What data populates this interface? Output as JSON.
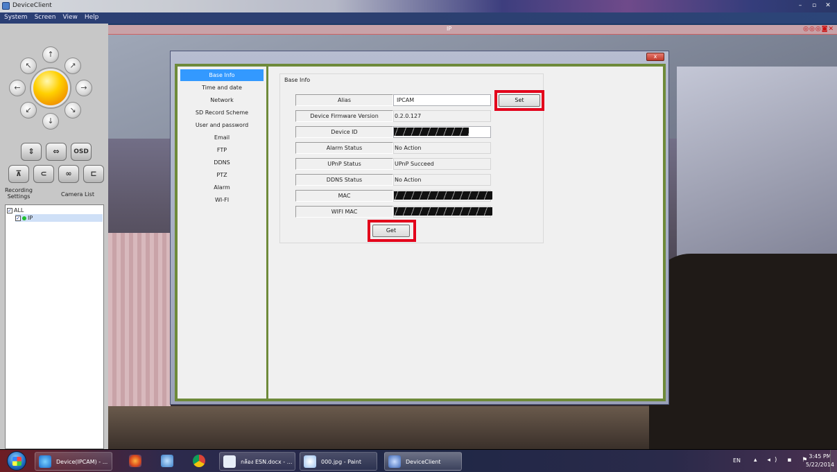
{
  "window": {
    "title": "DeviceClient",
    "controls": [
      "–",
      "▫",
      "✕"
    ]
  },
  "menu": [
    "System",
    "Screen",
    "View",
    "Help"
  ],
  "left_panel": {
    "ptz_icons": [
      "↖",
      "↑",
      "↗",
      "←",
      "→",
      "↙",
      "↓",
      "↘"
    ],
    "tools_row1": [
      "⇕",
      "⇔",
      "OSD"
    ],
    "tools_row2": [
      "⊼",
      "⊂",
      "∞",
      "⊏"
    ],
    "recording_settings_label": "Recording\nSettings",
    "camera_list_label": "Camera List",
    "tree": {
      "root": "ALL",
      "camera": "IP"
    }
  },
  "video": {
    "camera_name": "IP",
    "toolbar_icons": "◎◎◎◙✕"
  },
  "dialog": {
    "close_label": "x",
    "nav": [
      "Base Info",
      "Time and date",
      "Network",
      "SD Record Scheme",
      "User and password",
      "Email",
      "FTP",
      "DDNS",
      "PTZ",
      "Alarm",
      "WI-FI"
    ],
    "active_nav": "Base Info",
    "group_title": "Base Info",
    "fields": [
      {
        "label": "Alias",
        "value": "IPCAM"
      },
      {
        "label": "Device Firmware Version",
        "value": "0.2.0.127"
      },
      {
        "label": "Device ID",
        "value": ""
      },
      {
        "label": "Alarm Status",
        "value": "No Action"
      },
      {
        "label": "UPnP Status",
        "value": "UPnP Succeed"
      },
      {
        "label": "DDNS Status",
        "value": "No Action"
      },
      {
        "label": "MAC",
        "value": ""
      },
      {
        "label": "WIFI MAC",
        "value": ""
      }
    ],
    "set_label": "Set",
    "get_label": "Get",
    "highlight_color": "#e3001b"
  },
  "taskbar": {
    "tasks": [
      {
        "label": "Device(IPCAM) - ..."
      },
      {
        "label": "กล้อง ESN.docx - ..."
      },
      {
        "label": "000.jpg - Paint"
      },
      {
        "label": "DeviceClient"
      }
    ],
    "tray": {
      "lang": "EN",
      "icons": "▴ ◂) ▪ ⚑",
      "time": "3:45 PM",
      "date": "5/22/2014"
    }
  }
}
